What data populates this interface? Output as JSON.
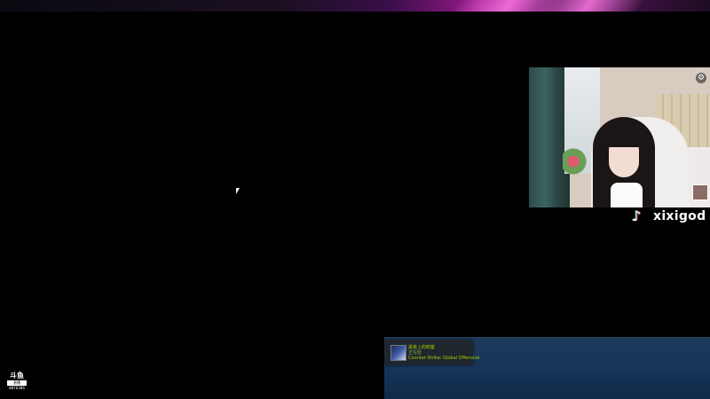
{
  "streamer": {
    "platform_icon": "tiktok-icon",
    "username": "xixigod"
  },
  "steam_notification": {
    "title": "黑夜上的刺客",
    "subtitle": "正在玩",
    "game": "Counter-Strike: Global Offensive"
  },
  "corner_logo": {
    "line1": "斗鱼",
    "line2": "直播",
    "line3": "8876386"
  },
  "colors": {
    "accent_magenta": "#9b1a8c",
    "steam_green": "#a4d007",
    "steam_blue": "#16355a"
  }
}
